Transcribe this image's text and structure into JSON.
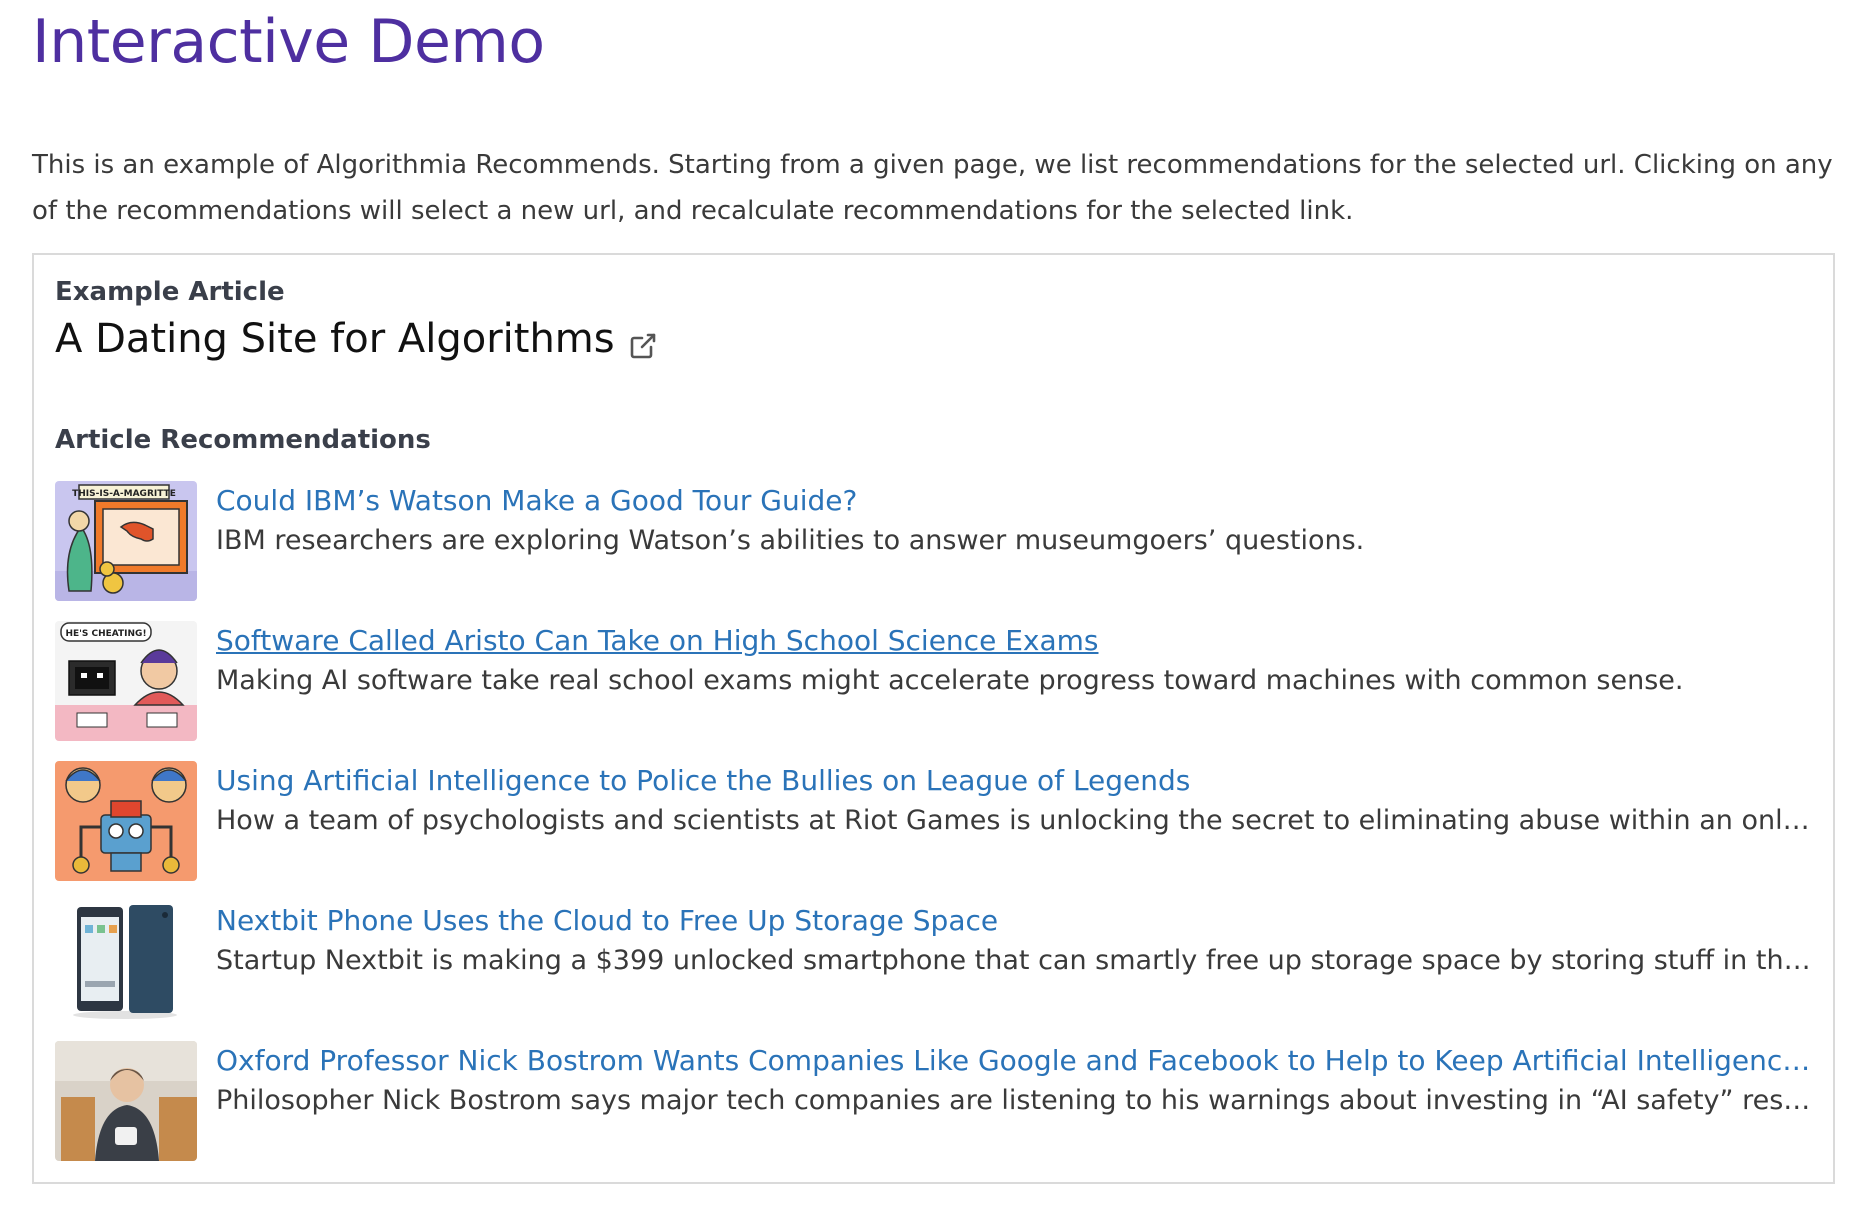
{
  "header": {
    "title": "Interactive Demo"
  },
  "intro": {
    "text": "This is an example of Algorithmia Recommends. Starting from a given page, we list recommendations for the selected url. Clicking on any of the recommendations will select a new url, and recalculate recommendations for the selected link."
  },
  "example": {
    "label": "Example Article",
    "title": "A Dating Site for Algorithms",
    "icon": "external-link-icon"
  },
  "recommendations": {
    "label": "Article Recommendations",
    "items": [
      {
        "title": "Could IBM’s Watson Make a Good Tour Guide?",
        "description": "IBM researchers are exploring Watson’s abilities to answer museumgoers’ questions.",
        "thumbnail_caption": "THIS-IS-A-MAGRITTE"
      },
      {
        "title": "Software Called Aristo Can Take on High School Science Exams",
        "description": "Making AI software take real school exams might accelerate progress toward machines with common sense.",
        "thumbnail_caption": "HE'S CHEATING!"
      },
      {
        "title": "Using Artificial Intelligence to Police the Bullies on League of Legends",
        "description": "How a team of psychologists and scientists at Riot Games is unlocking the secret to eliminating abuse within an online video game."
      },
      {
        "title": "Nextbit Phone Uses the Cloud to Free Up Storage Space",
        "description": "Startup Nextbit is making a $399 unlocked smartphone that can smartly free up storage space by storing stuff in the cloud."
      },
      {
        "title": "Oxford Professor Nick Bostrom Wants Companies Like Google and Facebook to Help to Keep Artificial Intelligence Friendly",
        "description": "Philosopher Nick Bostrom says major tech companies are listening to his warnings about investing in “AI safety” research."
      }
    ]
  },
  "colors": {
    "title": "#4e2fa0",
    "link": "#2a73b8",
    "text": "#3a3a3a",
    "border": "#dadada"
  }
}
